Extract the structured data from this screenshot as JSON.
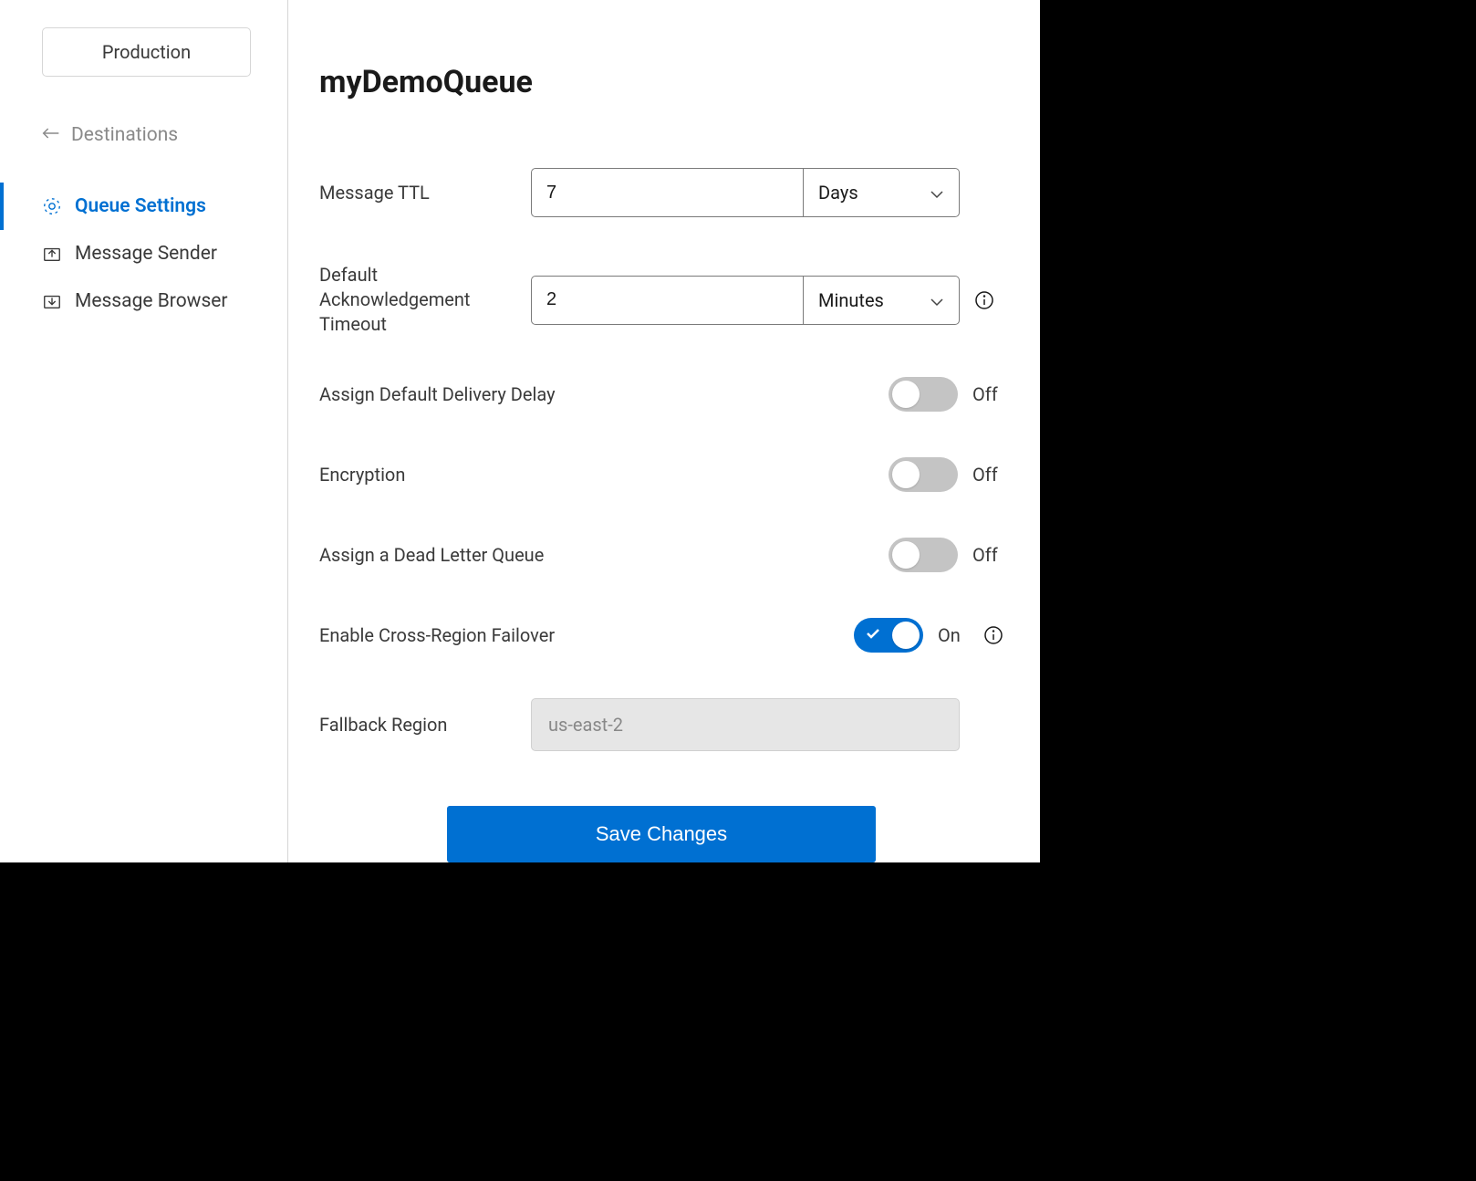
{
  "sidebar": {
    "environment": "Production",
    "back_link": "Destinations",
    "nav": [
      {
        "label": "Queue Settings",
        "active": true
      },
      {
        "label": "Message Sender",
        "active": false
      },
      {
        "label": "Message Browser",
        "active": false
      }
    ]
  },
  "page": {
    "title": "myDemoQueue"
  },
  "form": {
    "ttl": {
      "label": "Message TTL",
      "value": "7",
      "unit": "Days"
    },
    "ack_timeout": {
      "label": "Default Acknowledgement Timeout",
      "value": "2",
      "unit": "Minutes"
    },
    "delivery_delay": {
      "label": "Assign Default Delivery Delay",
      "state": "Off"
    },
    "encryption": {
      "label": "Encryption",
      "state": "Off"
    },
    "dead_letter": {
      "label": "Assign a Dead Letter Queue",
      "state": "Off"
    },
    "cross_region": {
      "label": "Enable Cross-Region Failover",
      "state": "On"
    },
    "fallback_region": {
      "label": "Fallback Region",
      "value": "us-east-2"
    },
    "save_button": "Save Changes"
  }
}
